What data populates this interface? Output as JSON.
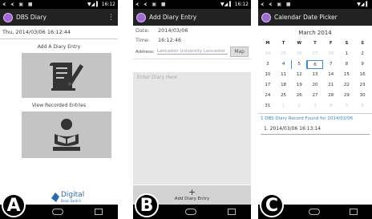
{
  "status": {
    "left": "⮜ ⮜ ▣ ■",
    "right": "▼◢ ▍ 16:12"
  },
  "statusC": {
    "right": "▼◢ ▍"
  },
  "panelA": {
    "title": "DBS Diary",
    "datetime": "Thu, 2014/03/06 16:12:44",
    "add_label": "Add A Diary Entry",
    "view_label": "View Recorded Entries",
    "logo_name": "Digital",
    "logo_sub": "Brain Switch",
    "letter": "A"
  },
  "panelB": {
    "title": "Add Diary Entry",
    "date_key": "Date:",
    "date_val": "2014/03/06",
    "time_key": "Time:",
    "time_val": "16:12:46",
    "addr_key": "Address:",
    "addr_val": "Lancaster University Lancaster",
    "map_label": "Map",
    "placeholder": "Enter Diary Here",
    "add_entry_label": "Add Diary Entry",
    "letter": "B"
  },
  "panelC": {
    "title": "Calendar Date Picker",
    "month": "March 2014",
    "weekdays": [
      "M",
      "T",
      "W",
      "T",
      "F",
      "S",
      "S"
    ],
    "found": "1 DBS Diary Record Found for 2014/03/06",
    "record": "1. 2014/03/06 16:13:14",
    "letter": "C"
  }
}
